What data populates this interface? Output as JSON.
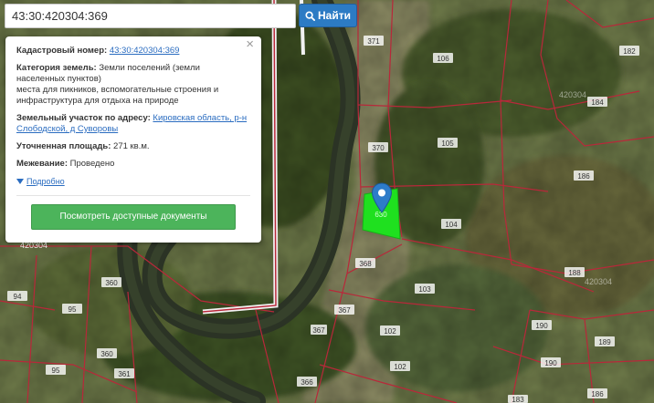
{
  "search": {
    "value": "43:30:420304:369",
    "button_label": "Найти",
    "button_icon": "search-icon"
  },
  "popup": {
    "cadastral_label": "Кадастровый номер:",
    "cadastral_value": "43:30:420304:369",
    "category_label": "Категория земель:",
    "category_value": "Земли поселений (земли населенных пунктов)",
    "usage_value": "места для пикников, вспомогательные строения и инфраструктура для отдыха на природе",
    "address_label": "Земельный участок по адресу:",
    "address_value": "Кировская область, р-н Слободской, д Суворовы",
    "area_label": "Уточненная площадь:",
    "area_value": "271 кв.м.",
    "survey_label": "Межевание:",
    "survey_value": "Проведено",
    "more_label": "Подробно",
    "docs_button": "Посмотреть доступные документы",
    "close_symbol": "×"
  },
  "map": {
    "quarter_labels": [
      "420304",
      "420304",
      "420304"
    ],
    "parcel_labels": [
      "371",
      "106",
      "182",
      "184",
      "370",
      "105",
      "186",
      "104",
      "368",
      "188",
      "103",
      "367",
      "190",
      "102",
      "189",
      "190",
      "102",
      "366",
      "186",
      "183",
      "360",
      "94",
      "95",
      "360",
      "95",
      "361",
      "367"
    ],
    "highlight_color": "#1fe01f",
    "boundary_color": "#b8283a"
  }
}
